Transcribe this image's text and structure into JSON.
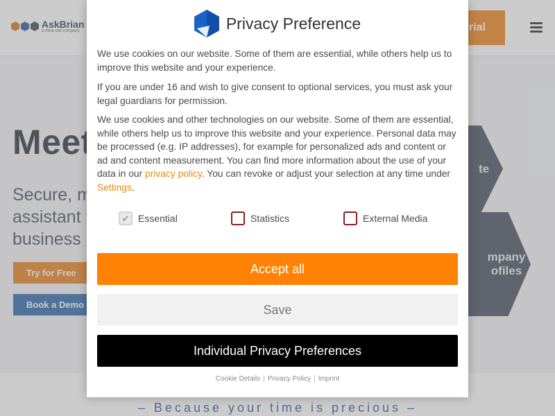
{
  "site": {
    "logo": {
      "name": "AskBrian",
      "tagline": "a think-cell company"
    },
    "header_cta": "rial",
    "hero": {
      "title": "Meet",
      "subtitle": "Secure, m\nassistant f\nbusiness p",
      "try_label": "Try for Free",
      "demo_label": "Book a Demo",
      "hex_a": "te",
      "hex_b": "mpany\nofiles"
    },
    "tagline": "– Because your time is precious –"
  },
  "modal": {
    "title": "Privacy Preference",
    "p1": "We use cookies on our website. Some of them are essential, while others help us to improve this website and your experience.",
    "p2": "If you are under 16 and wish to give consent to optional services, you must ask your legal guardians for permission.",
    "p3_before": "We use cookies and other technologies on our website. Some of them are essential, while others help us to improve this website and your experience. Personal data may be processed (e.g. IP addresses), for example for personalized ads and content or ad and content measurement. You can find more information about the use of your data in our ",
    "p3_link": "privacy policy",
    "p3_middle": ". You can revoke or adjust your selection at any time under ",
    "p3_settings": "Settings",
    "p3_end": ".",
    "checkboxes": [
      {
        "label": "Essential",
        "checked": true,
        "disabled": true
      },
      {
        "label": "Statistics",
        "checked": false,
        "disabled": false
      },
      {
        "label": "External Media",
        "checked": false,
        "disabled": false
      }
    ],
    "accept_label": "Accept all",
    "save_label": "Save",
    "individual_label": "Individual Privacy Preferences",
    "footer": {
      "cookie_details": "Cookie Details",
      "privacy_policy": "Privacy Policy",
      "imprint": "Imprint",
      "separator": "|"
    }
  },
  "colors": {
    "accent": "#ff8205",
    "checkbox_border": "#8b1c1c",
    "link": "#e88a0f",
    "brand_blue": "#1f5fa8"
  }
}
